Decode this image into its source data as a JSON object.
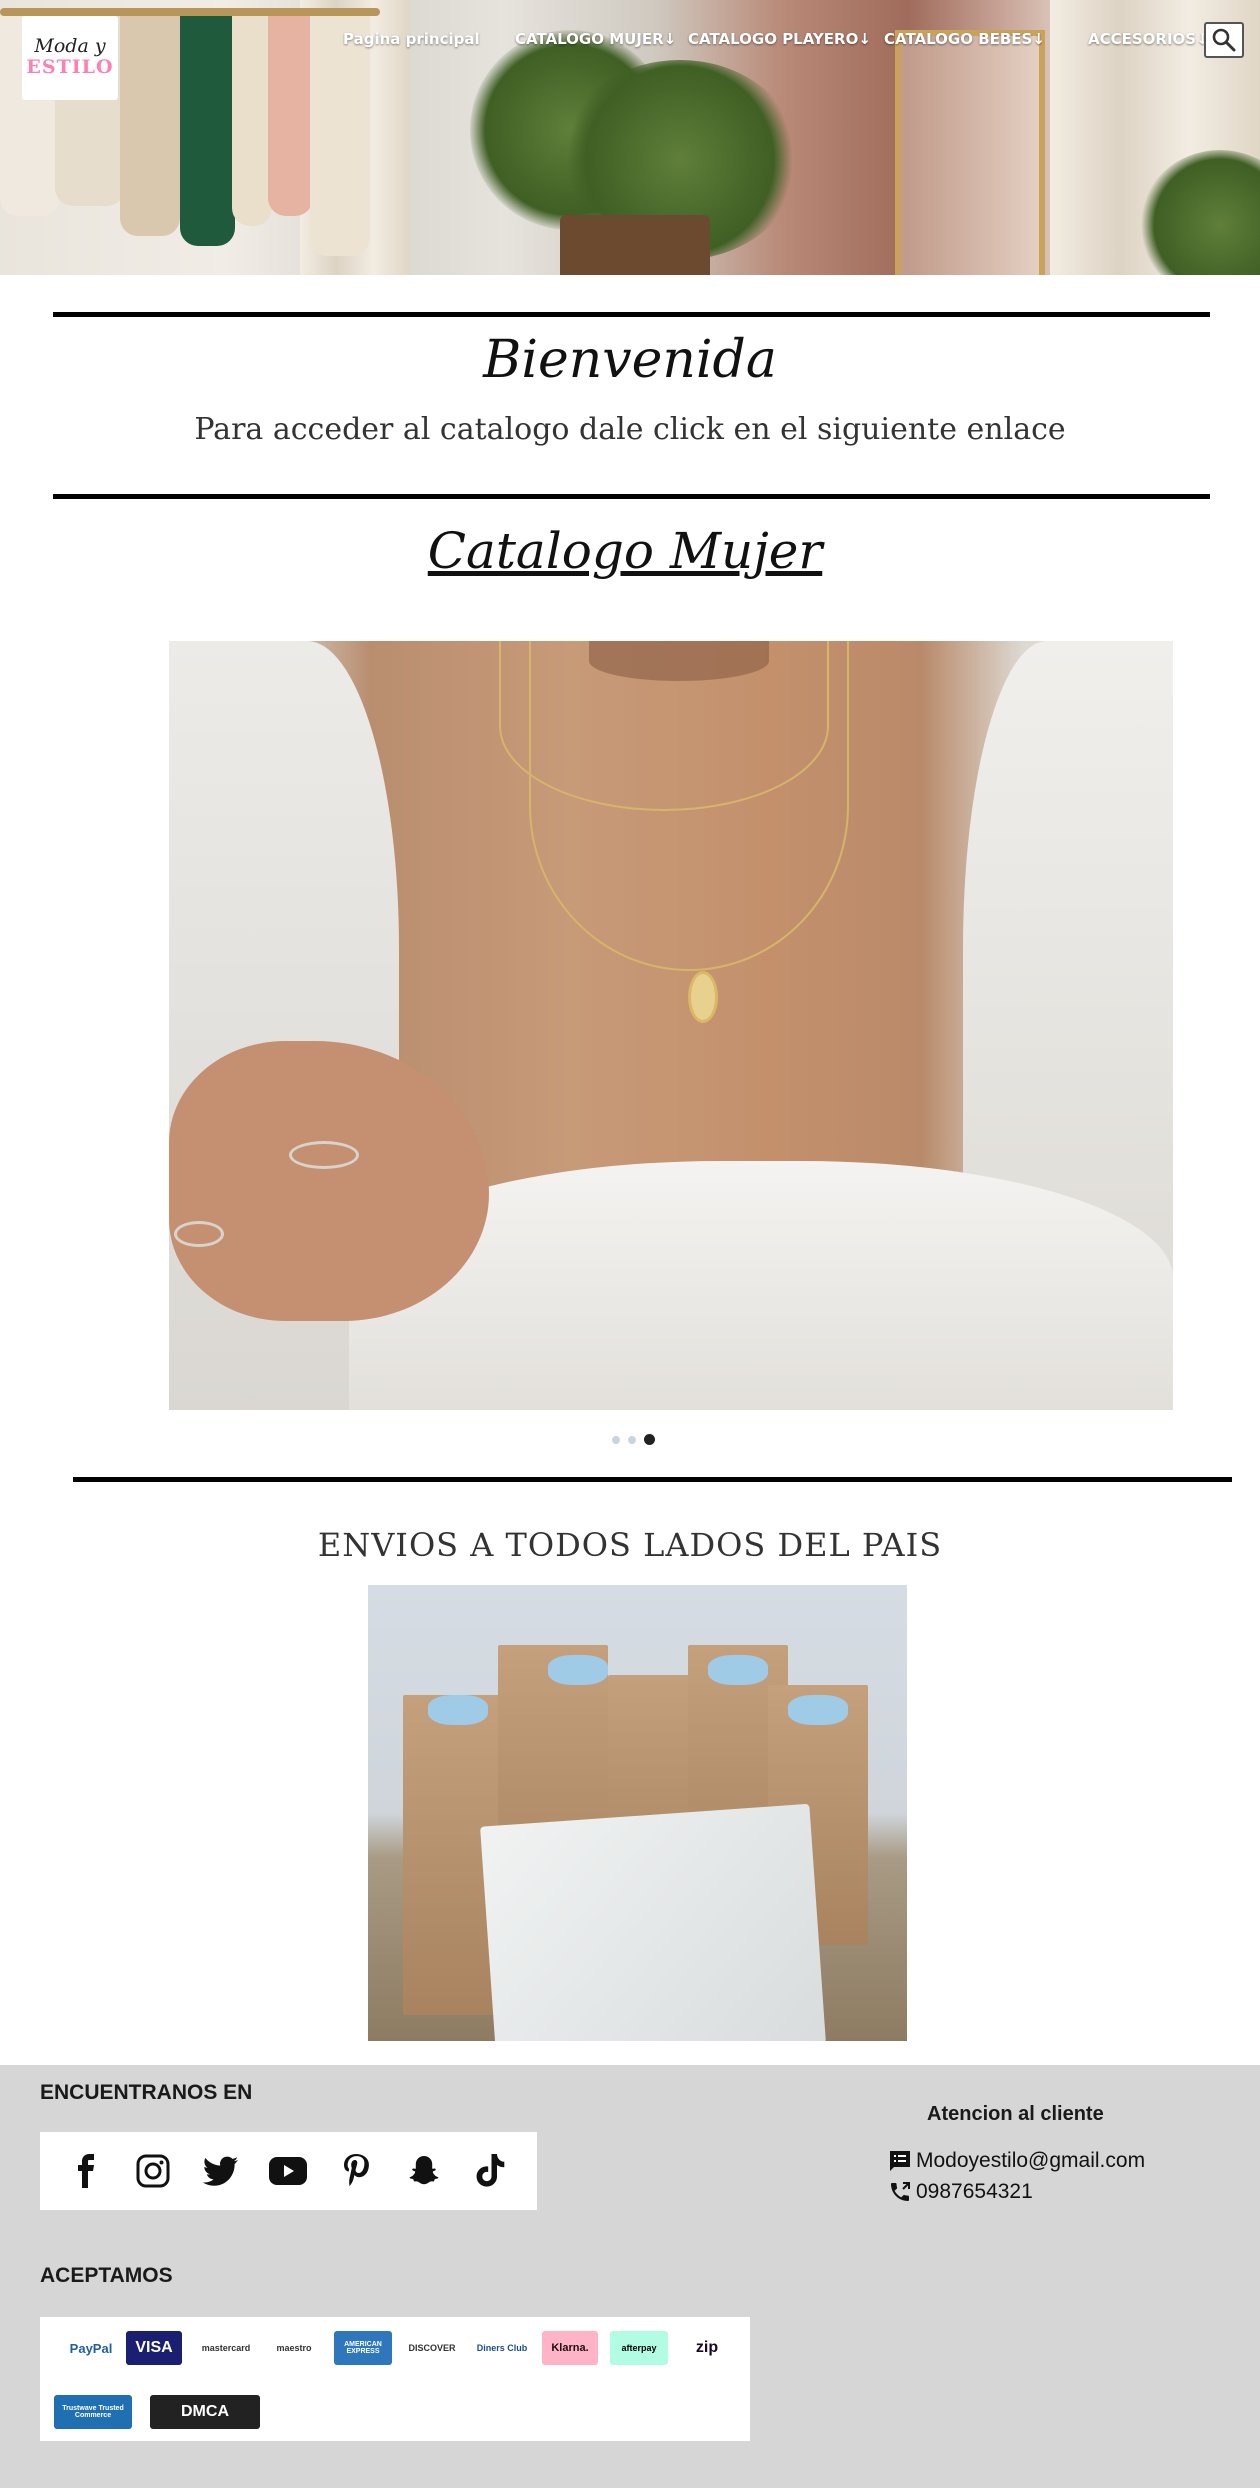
{
  "header": {
    "logo": {
      "line1": "Moda y",
      "line2": "ESTILO"
    },
    "nav": [
      {
        "label": "Pagina principal"
      },
      {
        "label": "CATALOGO MUJER↓"
      },
      {
        "label": "CATALOGO PLAYERO↓"
      },
      {
        "label": "CATALOGO BEBES↓"
      },
      {
        "label": "ACCESORIOS↓"
      }
    ],
    "search_icon": "search-icon"
  },
  "welcome": {
    "title": "Bienvenida",
    "subtitle": "Para acceder al catalogo dale click en el siguiente enlace",
    "catalog_link": "Catalogo Mujer"
  },
  "slider": {
    "slide_count": 3,
    "active_index": 2
  },
  "shipping": {
    "title": "ENVIOS A TODOS LADOS DEL PAIS"
  },
  "footer": {
    "social_heading": "ENCUENTRANOS EN",
    "social_icons": [
      "facebook-icon",
      "instagram-icon",
      "twitter-icon",
      "youtube-icon",
      "pinterest-icon",
      "snapchat-icon",
      "tiktok-icon"
    ],
    "customer_service": {
      "heading": "Atencion al cliente",
      "email": "Modoyestilo@gmail.com",
      "phone": "0987654321"
    },
    "payments_heading": "ACEPTAMOS",
    "payments": [
      {
        "label": "PayPal",
        "bg": "#ffffff",
        "fg": "#1f5fa8"
      },
      {
        "label": "VISA",
        "bg": "#1a1f71",
        "fg": "#ffffff"
      },
      {
        "label": "mastercard",
        "bg": "#ffffff",
        "fg": "#333333"
      },
      {
        "label": "maestro",
        "bg": "#ffffff",
        "fg": "#333333"
      },
      {
        "label": "AMERICAN EXPRESS",
        "bg": "#2e77bc",
        "fg": "#ffffff"
      },
      {
        "label": "DISCOVER",
        "bg": "#ffffff",
        "fg": "#333333"
      },
      {
        "label": "Diners Club",
        "bg": "#ffffff",
        "fg": "#1a4e8a"
      },
      {
        "label": "Klarna.",
        "bg": "#ffb3c7",
        "fg": "#17120f"
      },
      {
        "label": "afterpay",
        "bg": "#b2fce4",
        "fg": "#000000"
      },
      {
        "label": "zip",
        "bg": "#ffffff",
        "fg": "#1a0826"
      },
      {
        "label": "Trustwave Trusted Commerce",
        "bg": "#1f6fb2",
        "fg": "#ffffff"
      },
      {
        "label": "DMCA",
        "bg": "#222222",
        "fg": "#ffffff"
      }
    ],
    "colors": {
      "background": "#d6d6d6"
    }
  }
}
